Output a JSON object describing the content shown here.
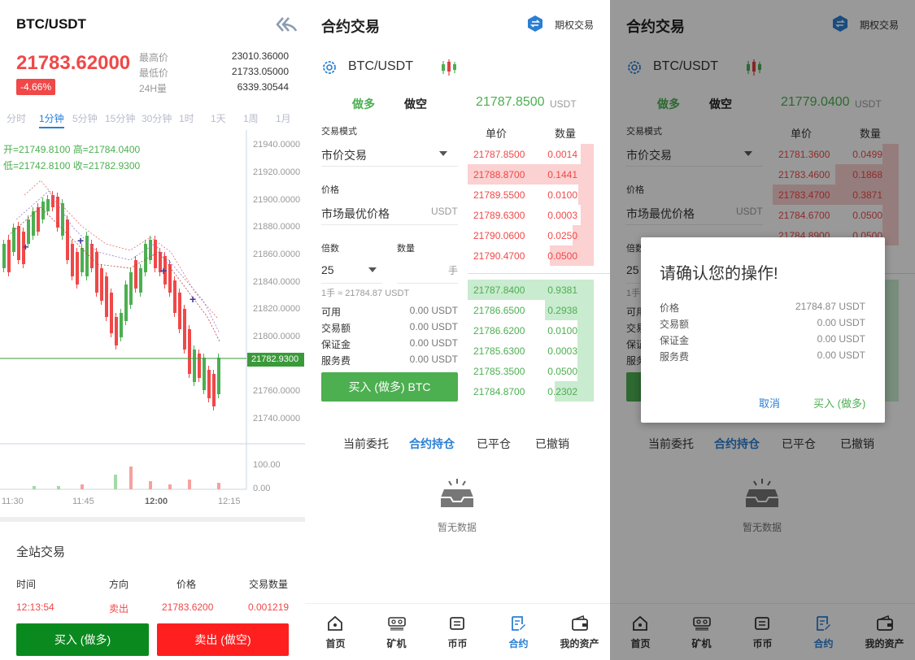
{
  "left": {
    "pair": "BTC/USDT",
    "price": "21783.62000",
    "change": "-4.66%",
    "stats": [
      {
        "label": "最高价",
        "value": "23010.36000"
      },
      {
        "label": "最低价",
        "value": "21733.05000"
      },
      {
        "label": "24H量",
        "value": "6339.30544"
      }
    ],
    "timeframes": [
      "分时",
      "1分钟",
      "5分钟",
      "15分钟",
      "30分钟",
      "1时",
      "1天",
      "1周",
      "1月"
    ],
    "active_timeframe": "1分钟",
    "ohlc": {
      "open_label": "开=",
      "open": "21749.8100",
      "high_label": "高=",
      "high": "21784.0400",
      "low_label": "低=",
      "low": "21742.8100",
      "close_label": "收=",
      "close": "21782.9300"
    },
    "price_axis": [
      "21940.0000",
      "21920.0000",
      "21900.0000",
      "21880.0000",
      "21860.0000",
      "21840.0000",
      "21820.0000",
      "21800.0000",
      "21780.0000",
      "21760.0000",
      "21740.0000"
    ],
    "last_price_tag": "21782.9300",
    "volume_axis": [
      "100.00",
      "0.00"
    ],
    "time_axis": [
      "11:30",
      "11:45",
      "12:00",
      "12:15"
    ],
    "trades_title": "全站交易",
    "trades_headers": [
      "时间",
      "方向",
      "价格",
      "交易数量"
    ],
    "trades_row": [
      "12:13:54",
      "卖出",
      "21783.6200",
      "0.001219"
    ],
    "buy_label": "买入 (做多)",
    "sell_label": "卖出 (做空)"
  },
  "contract": {
    "title": "合约交易",
    "options_label": "期权交易",
    "pair": "BTC/USDT",
    "tab_long": "做多",
    "tab_short": "做空",
    "unit": "USDT",
    "orderbook_headers": [
      "单价",
      "数量"
    ],
    "mode_label": "交易模式",
    "mode_value": "市价交易",
    "price_label": "价格",
    "price_value": "市场最优价格",
    "price_unit": "USDT",
    "leverage_label": "倍数",
    "leverage_value": "25",
    "qty_label": "数量",
    "qty_unit": "手",
    "lot_text": "1手 ≈ 21784.87 USDT",
    "rows": [
      {
        "label": "可用",
        "value": "0.00 USDT"
      },
      {
        "label": "交易额",
        "value": "0.00 USDT"
      },
      {
        "label": "保证金",
        "value": "0.00 USDT"
      },
      {
        "label": "服务费",
        "value": "0.00 USDT"
      }
    ],
    "buy_button": "买入 (做多) BTC",
    "order_tabs": [
      "当前委托",
      "合约持仓",
      "已平仓",
      "已撤销"
    ],
    "active_order_tab": "合约持仓",
    "empty_text": "暂无数据",
    "nav": [
      "首页",
      "矿机",
      "币币",
      "合约",
      "我的资产"
    ],
    "active_nav": "合约"
  },
  "panel2": {
    "current_price": "21787.8500",
    "asks": [
      {
        "price": "21787.8500",
        "qty": "0.0014",
        "depth": 0.1
      },
      {
        "price": "21788.8700",
        "qty": "0.1441",
        "depth": 1.0
      },
      {
        "price": "21789.5500",
        "qty": "0.0100",
        "depth": 0.12
      },
      {
        "price": "21789.6300",
        "qty": "0.0003",
        "depth": 0.1
      },
      {
        "price": "21790.0600",
        "qty": "0.0250",
        "depth": 0.17
      },
      {
        "price": "21790.4700",
        "qty": "0.0500",
        "depth": 0.35
      }
    ],
    "bids": [
      {
        "price": "21787.8400",
        "qty": "0.9381",
        "depth": 1.0
      },
      {
        "price": "21786.6500",
        "qty": "0.2938",
        "depth": 0.39
      },
      {
        "price": "21786.6200",
        "qty": "0.0100",
        "depth": 0.13
      },
      {
        "price": "21785.6300",
        "qty": "0.0003",
        "depth": 0.13
      },
      {
        "price": "21785.3500",
        "qty": "0.0500",
        "depth": 0.13
      },
      {
        "price": "21784.8700",
        "qty": "0.2302",
        "depth": 0.31
      }
    ]
  },
  "panel3": {
    "current_price": "21779.0400",
    "asks": [
      {
        "price": "21781.3600",
        "qty": "0.0499",
        "depth": 0.13
      },
      {
        "price": "21783.4600",
        "qty": "0.1868",
        "depth": 0.5
      },
      {
        "price": "21783.4700",
        "qty": "0.3871",
        "depth": 1.0
      },
      {
        "price": "21784.6700",
        "qty": "0.0500",
        "depth": 0.13
      },
      {
        "price": "21784.8900",
        "qty": "0.0500",
        "depth": 0.13
      }
    ],
    "dialog": {
      "title": "请确认您的操作!",
      "rows": [
        {
          "label": "价格",
          "value": "21784.87 USDT"
        },
        {
          "label": "交易额",
          "value": "0.00 USDT"
        },
        {
          "label": "保证金",
          "value": "0.00 USDT"
        },
        {
          "label": "服务费",
          "value": "0.00 USDT"
        }
      ],
      "cancel": "取消",
      "confirm": "买入 (做多)"
    }
  },
  "colors": {
    "up": "#4caf50",
    "down": "#f04848",
    "accent": "#2a7fd4",
    "buy": "#0a8a1e",
    "sell": "#ff1f1f"
  },
  "icons": [
    "back-arrow-icon",
    "exchange-icon",
    "gear-icon",
    "candlestick-icon",
    "empty-tray-icon",
    "home-icon",
    "miner-icon",
    "coin-icon",
    "contract-icon",
    "wallet-icon"
  ]
}
